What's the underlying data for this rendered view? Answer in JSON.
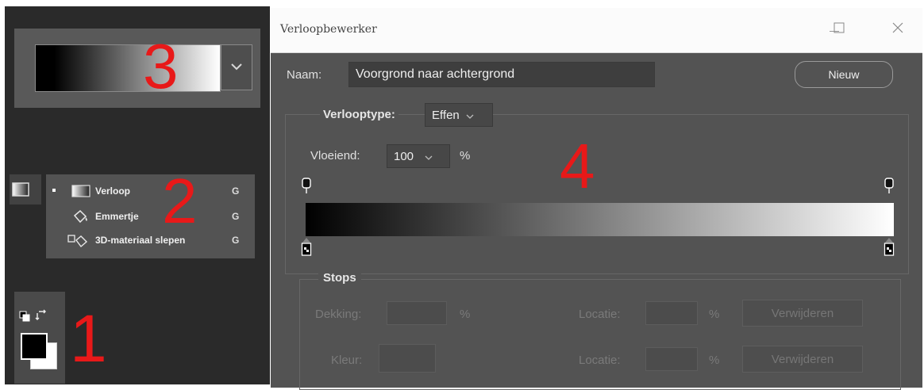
{
  "annotations": {
    "one": "1",
    "two": "2",
    "three": "3",
    "four": "4"
  },
  "tools_flyout": {
    "items": [
      {
        "label": "Verloop",
        "shortcut": "G",
        "icon": "gradient-tool-icon"
      },
      {
        "label": "Emmertje",
        "shortcut": "G",
        "icon": "paint-bucket-icon"
      },
      {
        "label": "3D-materiaal slepen",
        "shortcut": "G",
        "icon": "3d-material-drop-icon"
      }
    ]
  },
  "dialog": {
    "title": "Verloopbewerker",
    "name_label": "Naam:",
    "name_value": "Voorgrond naar achtergrond",
    "new_button": "Nieuw",
    "type_label": "Verlooptype:",
    "type_value": "Effen",
    "smooth_label": "Vloeiend:",
    "smooth_value": "100",
    "smooth_unit": "%",
    "gradient": {
      "start_color": "#000000",
      "end_color": "#ffffff"
    },
    "stops": {
      "legend": "Stops",
      "opacity_label": "Dekking:",
      "opacity_unit": "%",
      "location_label_1": "Locatie:",
      "location_unit_1": "%",
      "delete_button_1": "Verwijderen",
      "color_label": "Kleur:",
      "location_label_2": "Locatie:",
      "location_unit_2": "%",
      "delete_button_2": "Verwijderen"
    }
  },
  "colors": {
    "annotation_red": "#e81919",
    "panel_dark": "#2a2a2a",
    "dialog_bg": "#535353"
  }
}
